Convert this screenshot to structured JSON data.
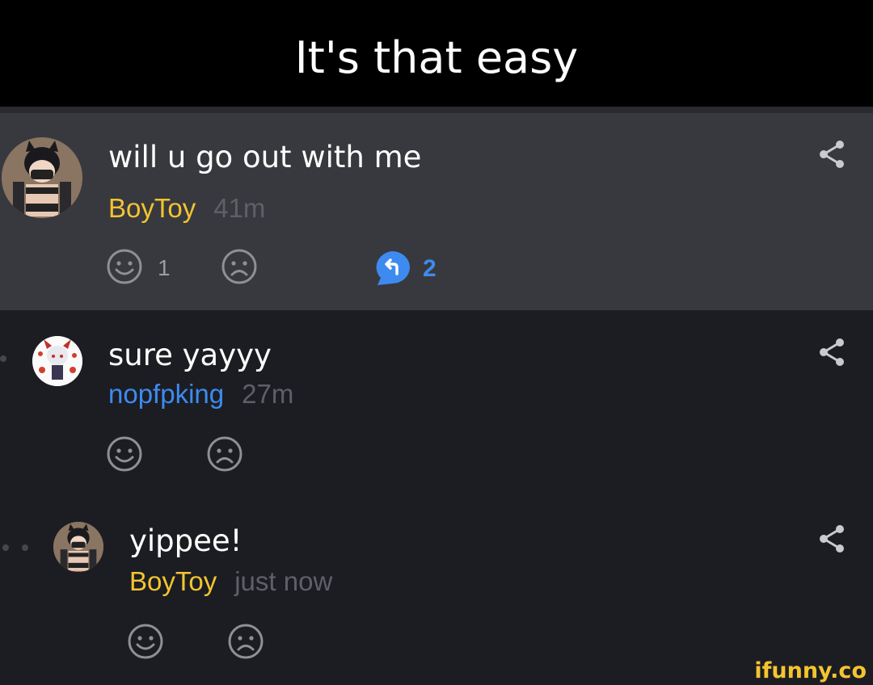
{
  "caption": "It's that easy",
  "comments": [
    {
      "text": "will u go out with me",
      "user": "BoyToy",
      "time": "41m",
      "smile_count": "1",
      "reply_count": "2"
    },
    {
      "text": "sure yayyy",
      "user": "nopfpking",
      "time": "27m"
    },
    {
      "text": "yippee!",
      "user": "BoyToy",
      "time": "just now"
    }
  ],
  "watermark": "ifunny.co",
  "colors": {
    "caption_bg": "#000000",
    "highlight_bg": "#38393e",
    "page_bg": "#1c1d22",
    "username_yellow": "#f4c430",
    "username_blue": "#3d8bf0",
    "timestamp": "#5e6067"
  },
  "icons": [
    "smile-icon",
    "frown-icon",
    "reply-icon",
    "share-icon"
  ]
}
